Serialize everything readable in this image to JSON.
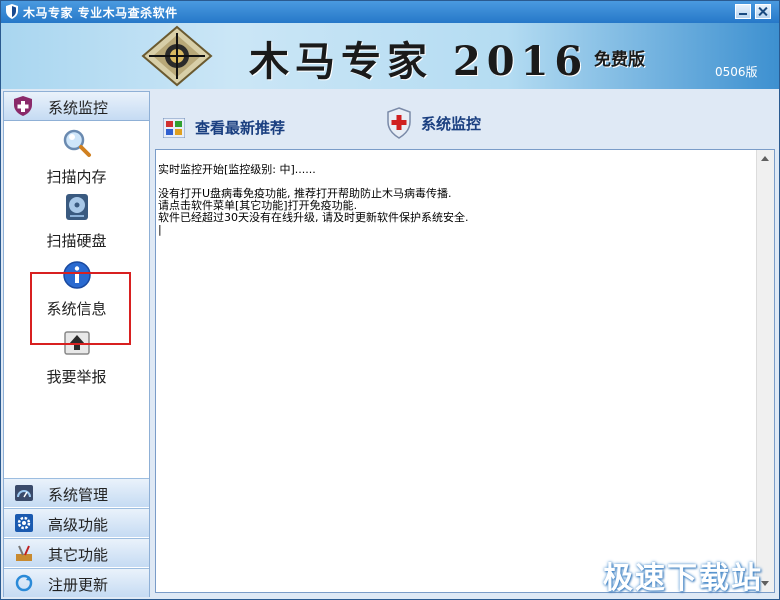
{
  "window": {
    "title": "木马专家  专业木马查杀软件",
    "icon": "shield-icon"
  },
  "banner": {
    "brand": "木马专家 2016",
    "edition": "免费版",
    "version": "0506版",
    "logo": "crosshair-logo"
  },
  "sidebar": {
    "header": "系统监控",
    "header_icon": "shield-plus-icon",
    "tools": [
      {
        "label": "扫描内存",
        "icon": "magnifier-icon"
      },
      {
        "label": "扫描硬盘",
        "icon": "hard-disk-icon"
      },
      {
        "label": "系统信息",
        "icon": "info-icon"
      },
      {
        "label": "我要举报",
        "icon": "upload-icon"
      }
    ],
    "categories": [
      {
        "label": "系统管理",
        "icon": "dashboard-icon"
      },
      {
        "label": "高级功能",
        "icon": "gear-icon"
      },
      {
        "label": "其它功能",
        "icon": "tools-icon"
      },
      {
        "label": "注册更新",
        "icon": "refresh-icon"
      }
    ]
  },
  "main": {
    "recommend_label": "查看最新推荐",
    "recommend_icon": "grid-icon",
    "monitor_label": "系统监控",
    "monitor_icon": "shield-cross-icon",
    "log_lines": [
      "实时监控开始[监控级别: 中]......",
      "",
      "没有打开U盘病毒免疫功能, 推荐打开帮助防止木马病毒传播.",
      "请点击软件菜单[其它功能]打开免疫功能.",
      "软件已经超过30天没有在线升级, 请及时更新软件保护系统安全.",
      "|"
    ]
  },
  "watermark": "极速下载站"
}
